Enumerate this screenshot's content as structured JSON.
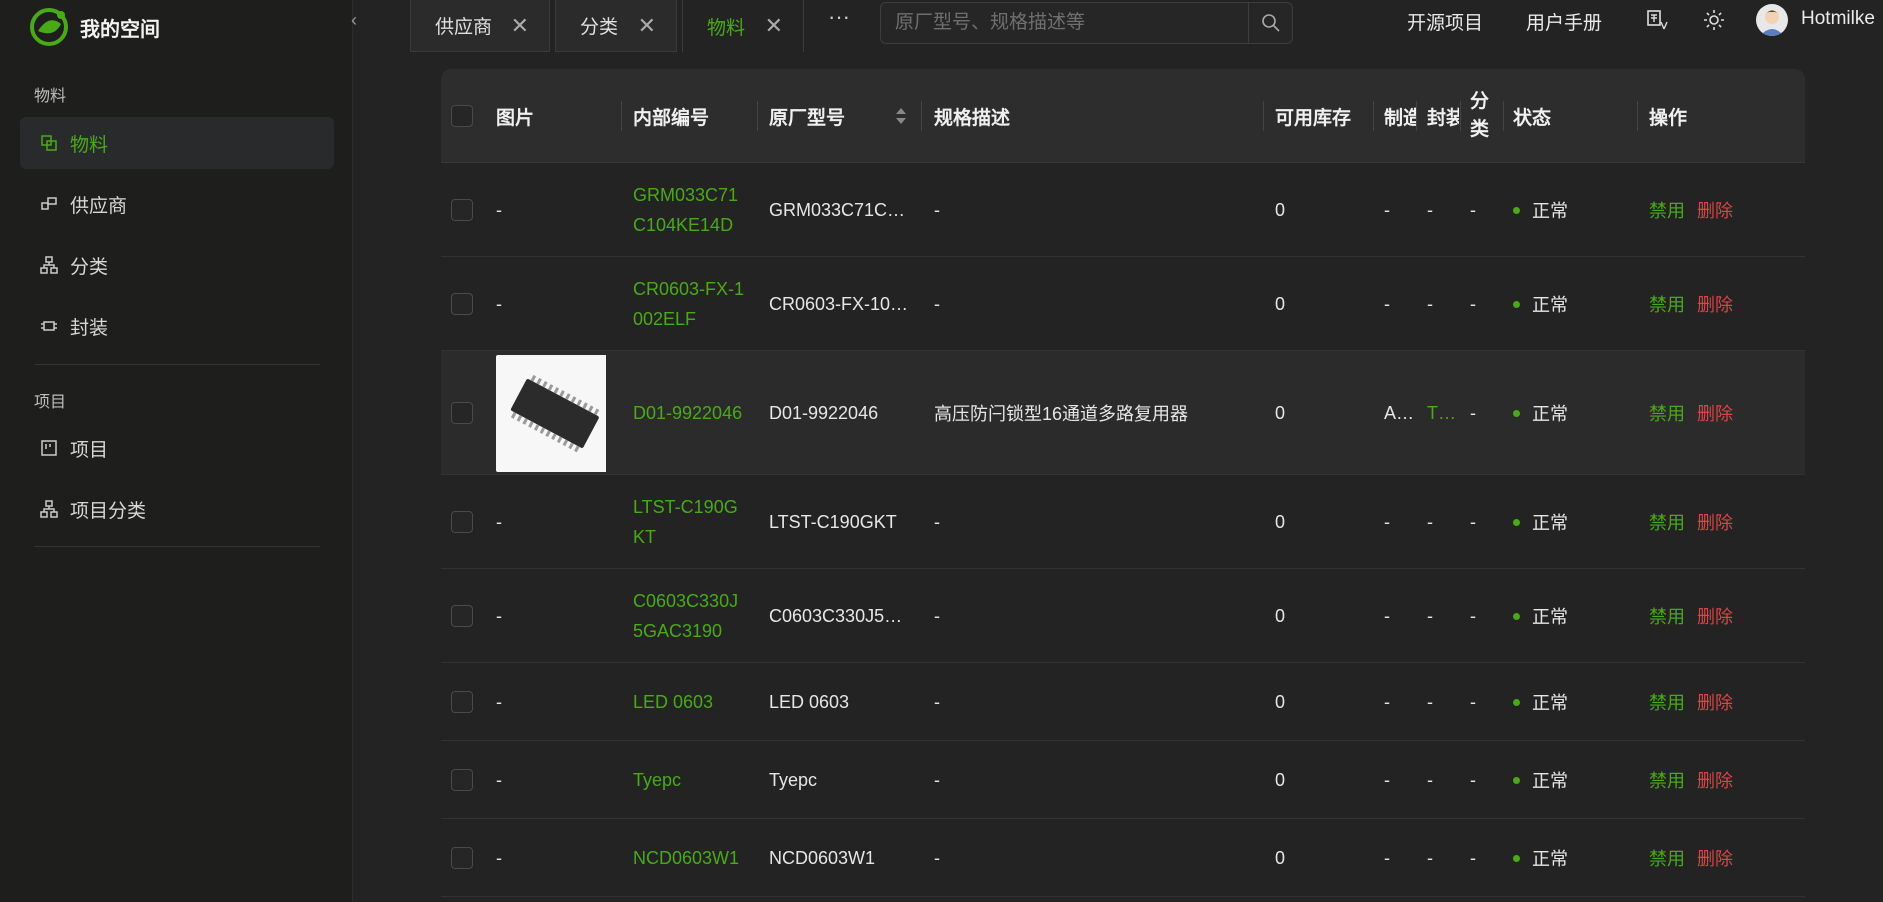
{
  "app": {
    "logo_text": "我的空间"
  },
  "sidebar": {
    "groups": [
      {
        "title": "物料",
        "items": [
          {
            "label": "物料",
            "icon": "copy-icon",
            "active": true
          },
          {
            "label": "供应商",
            "icon": "supplier-icon"
          },
          {
            "label": "分类",
            "icon": "tree-icon"
          },
          {
            "label": "封装",
            "icon": "package-icon"
          }
        ]
      },
      {
        "title": "项目",
        "items": [
          {
            "label": "项目",
            "icon": "project-icon"
          },
          {
            "label": "项目分类",
            "icon": "tree-icon"
          }
        ]
      }
    ]
  },
  "tabs": [
    {
      "label": "供应商",
      "active": false
    },
    {
      "label": "分类",
      "active": false
    },
    {
      "label": "物料",
      "active": true
    }
  ],
  "more_label": "···",
  "search": {
    "placeholder": "原厂型号、规格描述等",
    "value": ""
  },
  "header": {
    "open_source": "开源项目",
    "manual": "用户手册",
    "username": "Hotmilke"
  },
  "table": {
    "columns": {
      "image": "图片",
      "code": "内部编号",
      "mpn": "原厂型号",
      "spec": "规格描述",
      "stock": "可用库存",
      "mfr": "制造",
      "pkg": "封装",
      "cat": "分类",
      "status": "状态",
      "actions": "操作"
    },
    "actions": {
      "disable": "禁用",
      "delete": "删除"
    },
    "rows": [
      {
        "image": "-",
        "code": "GRM033C71C104KE14D",
        "mpn": "GRM033C71C…",
        "spec": "-",
        "stock": "0",
        "mfr": "-",
        "pkg": "-",
        "cat": "-",
        "status": "正常"
      },
      {
        "image": "-",
        "code": "CR0603-FX-1002ELF",
        "mpn": "CR0603-FX-10…",
        "spec": "-",
        "stock": "0",
        "mfr": "-",
        "pkg": "-",
        "cat": "-",
        "status": "正常"
      },
      {
        "image": "",
        "code": "D01-9922046",
        "mpn": "D01-9922046",
        "spec": "高压防闩锁型16通道多路复用器",
        "stock": "0",
        "mfr": "A…",
        "pkg": "T…",
        "cat": "-",
        "status": "正常"
      },
      {
        "image": "-",
        "code": "LTST-C190GKT",
        "mpn": "LTST-C190GKT",
        "spec": "-",
        "stock": "0",
        "mfr": "-",
        "pkg": "-",
        "cat": "-",
        "status": "正常"
      },
      {
        "image": "-",
        "code": "C0603C330J5GAC3190",
        "mpn": "C0603C330J5G…",
        "spec": "-",
        "stock": "0",
        "mfr": "-",
        "pkg": "-",
        "cat": "-",
        "status": "正常"
      },
      {
        "image": "-",
        "code": "LED 0603",
        "mpn": "LED 0603",
        "spec": "-",
        "stock": "0",
        "mfr": "-",
        "pkg": "-",
        "cat": "-",
        "status": "正常"
      },
      {
        "image": "-",
        "code": "Tyepc",
        "mpn": "Tyepc",
        "spec": "-",
        "stock": "0",
        "mfr": "-",
        "pkg": "-",
        "cat": "-",
        "status": "正常"
      },
      {
        "image": "-",
        "code": "NCD0603W1",
        "mpn": "NCD0603W1",
        "spec": "-",
        "stock": "0",
        "mfr": "-",
        "pkg": "-",
        "cat": "-",
        "status": "正常"
      }
    ]
  },
  "colors": {
    "accent": "#49aa19",
    "danger": "#dc4446",
    "bg": "#232323"
  }
}
